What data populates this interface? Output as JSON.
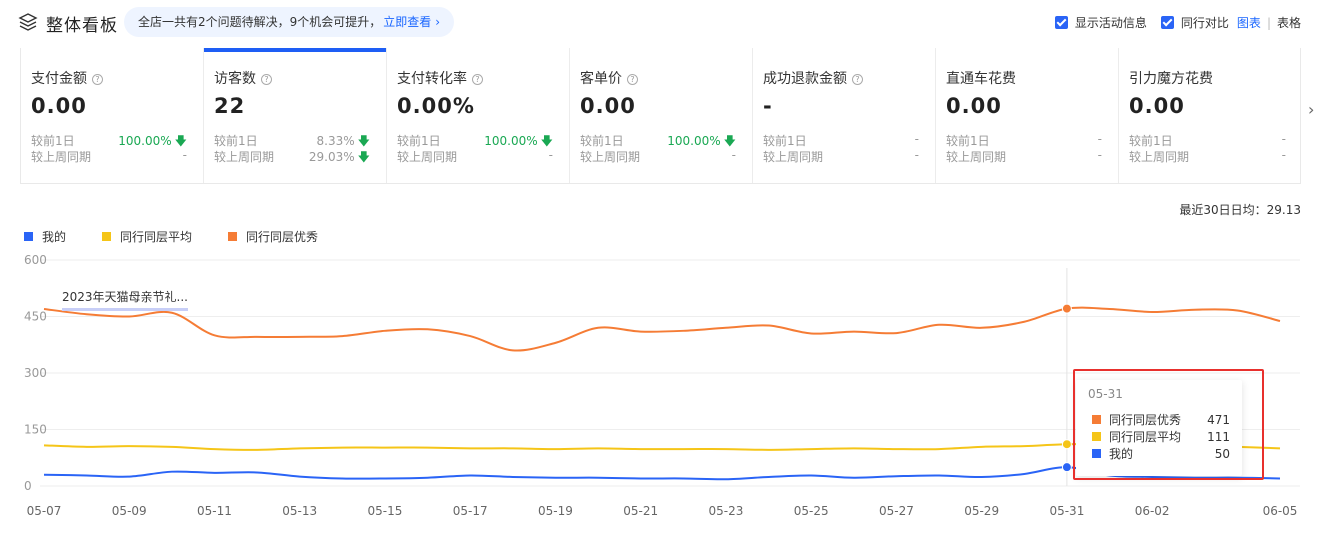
{
  "header": {
    "title": "整体看板",
    "notice_text": "全店一共有2个问题待解决，9个机会可提升，",
    "notice_link": "立即查看",
    "options": {
      "show_activity": "显示活动信息",
      "peer_compare": "同行对比",
      "view_chart": "图表",
      "view_table": "表格"
    }
  },
  "metrics": [
    {
      "label": "支付金额",
      "value": "0.00",
      "day_label": "较前1日",
      "day_pct": "100.00%",
      "day_dir": "down",
      "week_label": "较上周同期",
      "week_pct": "-"
    },
    {
      "label": "访客数",
      "value": "22",
      "day_label": "较前1日",
      "day_pct": "8.33%",
      "day_dir": "down",
      "week_label": "较上周同期",
      "week_pct": "29.03%",
      "week_dir": "down"
    },
    {
      "label": "支付转化率",
      "value": "0.00%",
      "day_label": "较前1日",
      "day_pct": "100.00%",
      "day_dir": "down",
      "week_label": "较上周同期",
      "week_pct": "-"
    },
    {
      "label": "客单价",
      "value": "0.00",
      "day_label": "较前1日",
      "day_pct": "100.00%",
      "day_dir": "down",
      "week_label": "较上周同期",
      "week_pct": "-"
    },
    {
      "label": "成功退款金额",
      "value": "-",
      "day_label": "较前1日",
      "day_pct": "-",
      "week_label": "较上周同期",
      "week_pct": "-"
    },
    {
      "label": "直通车花费",
      "value": "0.00",
      "day_label": "较前1日",
      "day_pct": "-",
      "week_label": "较上周同期",
      "week_pct": "-"
    },
    {
      "label": "引力魔方花费",
      "value": "0.00",
      "day_label": "较前1日",
      "day_pct": "-",
      "week_label": "较上周同期",
      "week_pct": "-"
    }
  ],
  "chart_meta": {
    "avg_note": "最近30日日均：29.13",
    "annotation": "2023年天猫母亲节礼..."
  },
  "chart_data": {
    "type": "line",
    "ylim": [
      0,
      600
    ],
    "yticks": [
      0,
      150,
      300,
      450,
      600
    ],
    "xtick_labels": [
      "05-07",
      "05-09",
      "05-11",
      "05-13",
      "05-15",
      "05-17",
      "05-19",
      "05-21",
      "05-23",
      "05-25",
      "05-27",
      "05-29",
      "05-31",
      "06-02",
      "06-05"
    ],
    "x": [
      "05-07",
      "05-08",
      "05-09",
      "05-10",
      "05-11",
      "05-12",
      "05-13",
      "05-14",
      "05-15",
      "05-16",
      "05-17",
      "05-18",
      "05-19",
      "05-20",
      "05-21",
      "05-22",
      "05-23",
      "05-24",
      "05-25",
      "05-26",
      "05-27",
      "05-28",
      "05-29",
      "05-30",
      "05-31",
      "06-01",
      "06-02",
      "06-03",
      "06-04",
      "06-05"
    ],
    "series": [
      {
        "name": "我的",
        "color": "#2a64f6",
        "values": [
          30,
          28,
          25,
          38,
          35,
          36,
          25,
          20,
          20,
          22,
          28,
          24,
          22,
          22,
          20,
          20,
          18,
          24,
          28,
          22,
          26,
          28,
          24,
          32,
          50,
          28,
          24,
          22,
          22,
          20
        ]
      },
      {
        "name": "同行同层平均",
        "color": "#f5c518",
        "values": [
          108,
          104,
          106,
          104,
          98,
          96,
          100,
          102,
          102,
          102,
          100,
          100,
          98,
          100,
          98,
          98,
          98,
          96,
          98,
          100,
          98,
          98,
          104,
          106,
          111,
          110,
          108,
          106,
          104,
          100
        ]
      },
      {
        "name": "同行同层优秀",
        "color": "#f57c35",
        "values": [
          470,
          456,
          450,
          460,
          400,
          396,
          396,
          398,
          412,
          416,
          398,
          360,
          380,
          420,
          410,
          412,
          420,
          426,
          405,
          410,
          406,
          428,
          420,
          436,
          471,
          470,
          462,
          468,
          466,
          438
        ]
      }
    ],
    "tooltip": {
      "date": "05-31",
      "items": [
        {
          "name": "同行同层优秀",
          "value": "471",
          "color": "#f57c35"
        },
        {
          "name": "同行同层平均",
          "value": "111",
          "color": "#f5c518"
        },
        {
          "name": "我的",
          "value": "50",
          "color": "#2a64f6"
        }
      ]
    }
  }
}
